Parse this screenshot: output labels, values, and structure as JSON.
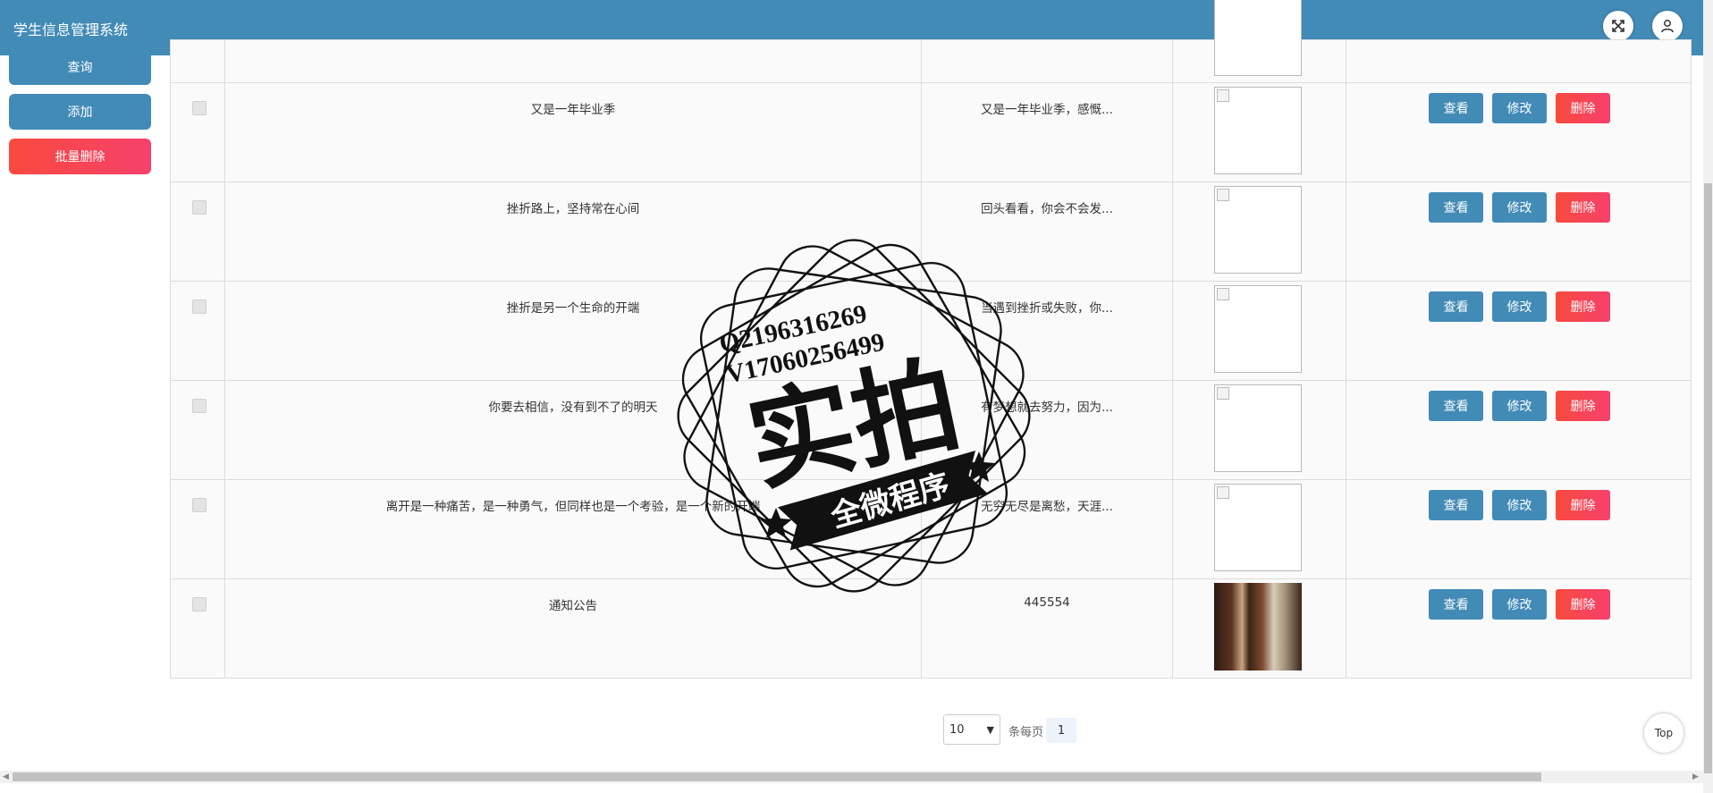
{
  "header": {
    "title": "学生信息管理系统",
    "fullscreen_icon": "expand-icon",
    "user_icon": "user-icon"
  },
  "sidebar": {
    "query": "查询",
    "add": "添加",
    "batch_delete": "批量删除"
  },
  "table": {
    "rows": [
      {
        "title": "",
        "intro": "",
        "pic": "broken"
      },
      {
        "title": "又是一年毕业季",
        "intro": "又是一年毕业季，感慨...",
        "pic": "broken"
      },
      {
        "title": "挫折路上，坚持常在心间",
        "intro": "回头看看，你会不会发...",
        "pic": "broken"
      },
      {
        "title": "挫折是另一个生命的开端",
        "intro": "当遇到挫折或失败，你...",
        "pic": "broken"
      },
      {
        "title": "你要去相信，没有到不了的明天",
        "intro": "有梦想就去努力，因为...",
        "pic": "broken"
      },
      {
        "title": "离开是一种痛苦，是一种勇气，但同样也是一个考验，是一个新的开端",
        "intro": "无穷无尽是离愁，天涯...",
        "pic": "broken"
      },
      {
        "title": "通知公告",
        "intro": "445554",
        "pic": "photo"
      }
    ],
    "view_label": "查看",
    "edit_label": "修改",
    "delete_label": "删除"
  },
  "pager": {
    "page_size": "10",
    "per_page_label": "条每页",
    "current_page": "1"
  },
  "top_button": "Top",
  "watermark": {
    "line1": "Q2196316269",
    "line2": "V17060256499",
    "big": "实拍",
    "banner": "全微程序"
  },
  "colors": {
    "primary": "#428bb7",
    "danger": "#f84a3e"
  }
}
